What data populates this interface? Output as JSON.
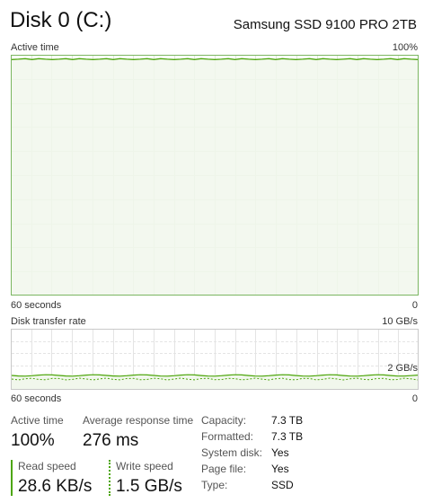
{
  "header": {
    "title": "Disk 0 (C:)",
    "model": "Samsung SSD 9100 PRO 2TB"
  },
  "active_time_graph": {
    "label": "Active time",
    "max_label": "100%",
    "time_label": "60 seconds",
    "min_label": "0",
    "value_percent": 99
  },
  "transfer_graph": {
    "label": "Disk transfer rate",
    "max_label": "10 GB/s",
    "mid_label": "2 GB/s",
    "time_label": "60 seconds",
    "min_label": "0"
  },
  "stats": {
    "active_time_label": "Active time",
    "active_time_value": "100%",
    "response_label": "Average response time",
    "response_value": "276 ms",
    "read_label": "Read speed",
    "read_value": "28.6 KB/s",
    "write_label": "Write speed",
    "write_value": "1.5 GB/s"
  },
  "properties": [
    {
      "name": "Capacity:",
      "value": "7.3 TB"
    },
    {
      "name": "Formatted:",
      "value": "7.3 TB"
    },
    {
      "name": "System disk:",
      "value": "Yes"
    },
    {
      "name": "Page file:",
      "value": "Yes"
    },
    {
      "name": "Type:",
      "value": "SSD"
    }
  ],
  "colors": {
    "accent": "#4da60c",
    "fill": "#f1f7ec",
    "grid": "#dde9d3",
    "border": "#7bb661"
  }
}
